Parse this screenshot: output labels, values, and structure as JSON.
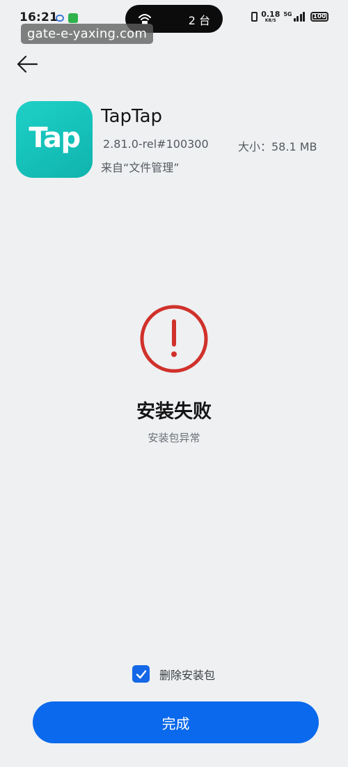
{
  "status_bar": {
    "time": "16:21",
    "island_count": "2 台",
    "net_speed": "0.18",
    "net_speed_unit": "KB/S",
    "network_type": "5G",
    "battery": "100"
  },
  "watermark": "gate-e-yaxing.com",
  "app": {
    "name": "TapTap",
    "icon_text": "Tap",
    "icon_color": "#18c4bb",
    "version": "2.81.0-rel#100300",
    "size": "大小：58.1 MB",
    "source": "来自“文件管理”"
  },
  "result": {
    "title": "安装失败",
    "subtitle": "安装包异常",
    "status_color": "#d1312b"
  },
  "options": {
    "delete_package_label": "删除安装包",
    "delete_package_checked": true
  },
  "actions": {
    "done_label": "完成",
    "accent": "#0a69ec"
  }
}
